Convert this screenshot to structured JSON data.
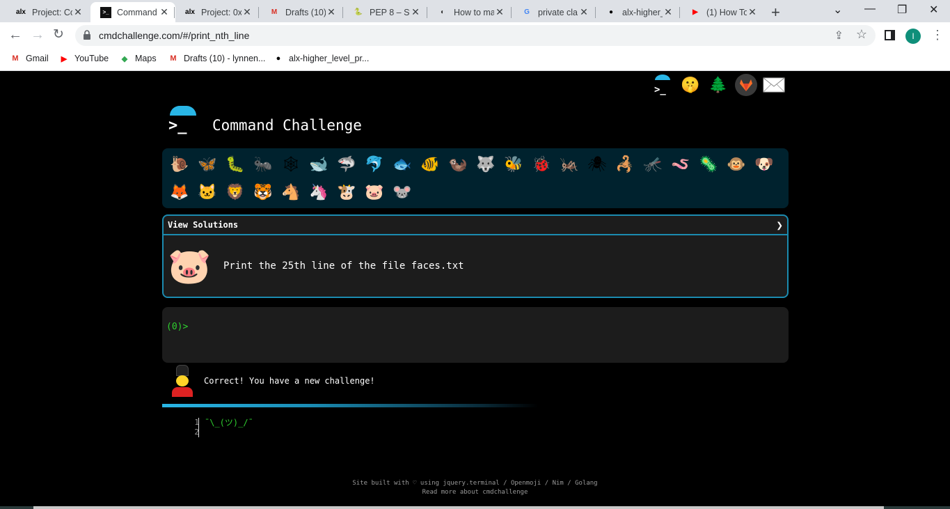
{
  "browser": {
    "tabs": [
      {
        "title": "Project: Co",
        "icon": "alx-icon",
        "glyph": "alx",
        "color": "#000"
      },
      {
        "title": "Command",
        "icon": "terminal-icon",
        "glyph": ">_",
        "color": "#fff",
        "active": true
      },
      {
        "title": "Project: 0x",
        "icon": "alx-icon",
        "glyph": "alx",
        "color": "#000"
      },
      {
        "title": "Drafts (10)",
        "icon": "gmail-icon",
        "glyph": "M",
        "color": "#d93025"
      },
      {
        "title": "PEP 8 – Sty",
        "icon": "python-icon",
        "glyph": "🐍",
        "color": "#3776ab"
      },
      {
        "title": "How to ma",
        "icon": "quora-icon",
        "glyph": "◐",
        "color": "#333"
      },
      {
        "title": "private cla",
        "icon": "google-icon",
        "glyph": "G",
        "color": "#4285f4"
      },
      {
        "title": "alx-higher_",
        "icon": "github-icon",
        "glyph": "●",
        "color": "#000"
      },
      {
        "title": "(1) How To",
        "icon": "youtube-icon",
        "glyph": "▶",
        "color": "#ff0000"
      }
    ],
    "url": "cmdchallenge.com/#/print_nth_line",
    "profile_initial": "I",
    "bookmarks": [
      {
        "label": "Gmail",
        "icon": "gmail-icon",
        "glyph": "M",
        "color": "#d93025"
      },
      {
        "label": "YouTube",
        "icon": "youtube-icon",
        "glyph": "▶",
        "color": "#ff0000"
      },
      {
        "label": "Maps",
        "icon": "maps-icon",
        "glyph": "◆",
        "color": "#34a853"
      },
      {
        "label": "Drafts (10) - lynnen...",
        "icon": "gmail-icon",
        "glyph": "M",
        "color": "#d93025"
      },
      {
        "label": "alx-higher_level_pr...",
        "icon": "github-icon",
        "glyph": "●",
        "color": "#000"
      }
    ]
  },
  "page": {
    "title": "Command Challenge",
    "top_icons": [
      "terminal-icon",
      "shushing-face-icon",
      "tree-icon",
      "gitlab-icon",
      "mail-icon"
    ],
    "animals": [
      "🐌",
      "🦋",
      "🐛",
      "🐜",
      "🕸",
      "🐋",
      "🦈",
      "🐬",
      "🐟",
      "🐠",
      "🦦",
      "🐺",
      "🐝",
      "🐞",
      "🦗",
      "🕷",
      "🦂",
      "🦟",
      "🪱",
      "🦠",
      "🐵",
      "🐶",
      "🦊",
      "🐱",
      "🦁",
      "🐯",
      "🐴",
      "🦄",
      "🐮",
      "🐷",
      "🐭"
    ],
    "solutions_header": "View Solutions",
    "task_icon": "🐷",
    "task": "Print the 25th line of the file faces.txt",
    "prompt": "(0)>",
    "status_message": "Correct! You have a new challenge!",
    "editor": {
      "line_numbers": [
        "1",
        "2"
      ],
      "lines": [
        "¯\\_(ツ)_/¯",
        ""
      ]
    },
    "footer": {
      "line1": "Site built with ♡ using jquery.terminal / Openmoji / Nim / Golang",
      "line2": "Read more about cmdchallenge"
    }
  }
}
